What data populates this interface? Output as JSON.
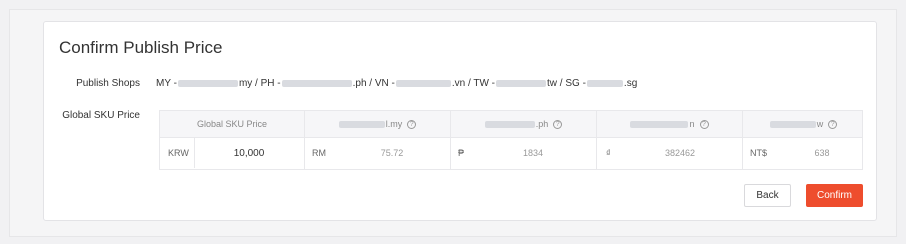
{
  "dialog": {
    "title": "Confirm Publish Price",
    "publish_shops_label": "Publish Shops",
    "global_sku_price_label": "Global SKU Price",
    "shops": {
      "my_prefix": "MY - ",
      "my_suffix": "my / PH - ",
      "ph_suffix": ".ph / VN - ",
      "vn_suffix": ".vn / TW - ",
      "tw_suffix": "tw / SG - ",
      "sg_suffix": ".sg"
    }
  },
  "table": {
    "header_global": "Global SKU Price",
    "header_my_suffix": "l.my",
    "header_ph_suffix": ".ph",
    "header_vn_suffix": "n",
    "header_tw_suffix": "w",
    "help_glyph": "?",
    "global_currency": "KRW",
    "global_value": "10,000",
    "my_currency": "RM",
    "my_value": "75.72",
    "ph_currency": "₱",
    "ph_value": "1834",
    "vn_currency": "₫",
    "vn_value": "382462",
    "tw_currency": "NT$",
    "tw_value": "638"
  },
  "actions": {
    "back_label": "Back",
    "confirm_label": "Confirm"
  },
  "colors": {
    "primary": "#ee4d2d",
    "redacted": "#d9dbe0"
  }
}
